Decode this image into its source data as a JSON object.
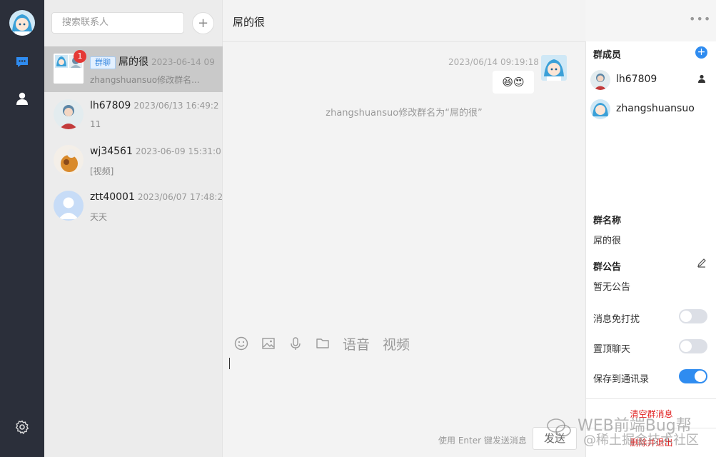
{
  "search": {
    "placeholder": "搜索联系人",
    "add_label": "+"
  },
  "contacts": [
    {
      "tag": "群聊",
      "name": "屌的很",
      "time": "2023-06-14 09",
      "preview": "zhangshuansuo修改群名...",
      "badge": "1"
    },
    {
      "name": "lh67809",
      "time": "2023/06/13 16:49:2",
      "preview": "11"
    },
    {
      "name": "wj34561",
      "time": "2023-06-09 15:31:0",
      "preview": "[视频]"
    },
    {
      "name": "ztt40001",
      "time": "2023/06/07 17:48:2",
      "preview": "天天"
    }
  ],
  "chat": {
    "title": "屌的很",
    "more": "•••",
    "message_time": "2023/06/14 09:19:18",
    "message_content": "😆😍",
    "system_message": "zhangshuansuo修改群名为“屌的很”",
    "toolbar": {
      "voice_label": "语音",
      "video_label": "视频"
    },
    "send_hint": "使用 Enter 键发送消息",
    "send_label": "发送"
  },
  "panel": {
    "members_title": "群成员",
    "add_member": "+",
    "members": [
      {
        "name": "lh67809"
      },
      {
        "name": "zhangshuansuo"
      }
    ],
    "group_name_title": "群名称",
    "group_name": "屌的很",
    "notice_title": "群公告",
    "notice": "暂无公告",
    "settings": [
      {
        "label": "消息免打扰",
        "on": false
      },
      {
        "label": "置顶聊天",
        "on": false
      },
      {
        "label": "保存到通讯录",
        "on": true
      }
    ],
    "clear_label": "清空群消息",
    "leave_label": "删除并退出"
  },
  "watermark": {
    "line1": "WEB前端Bug帮",
    "line2": "@稀土掘金技术社区"
  },
  "colors": {
    "accent": "#2f8cf0",
    "nav_bg": "#2b2f3a",
    "danger": "#e02020",
    "badge": "#e53935"
  }
}
